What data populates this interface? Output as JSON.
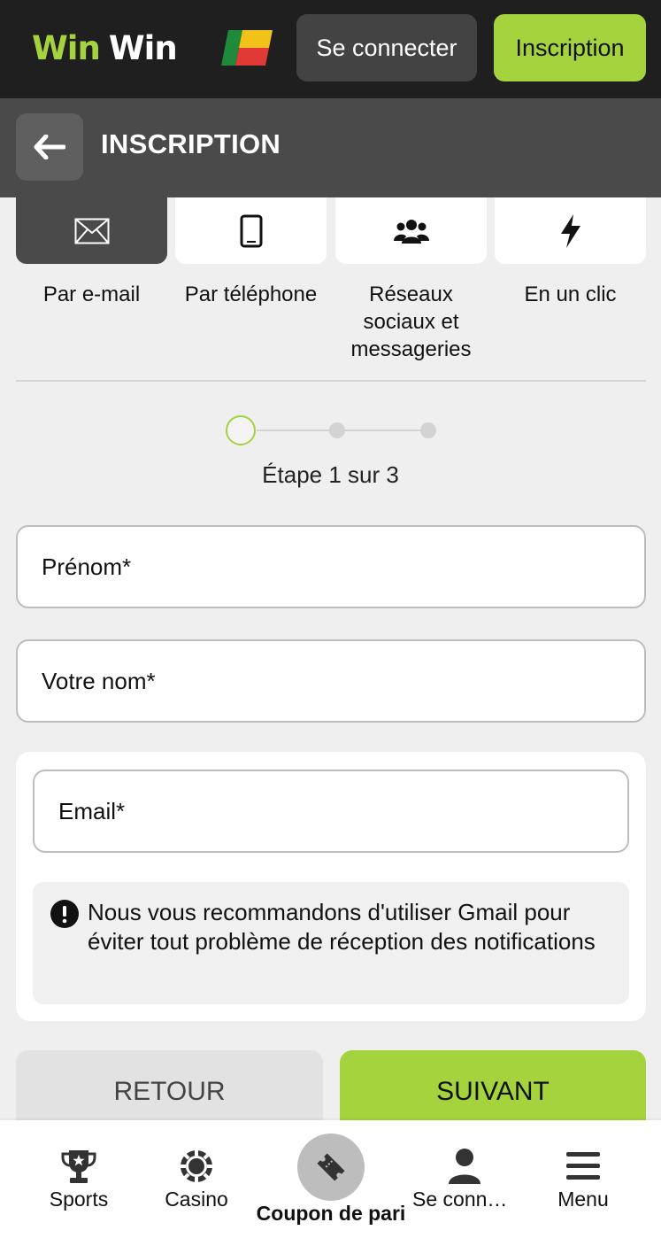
{
  "header": {
    "logo_part1": "Win",
    "logo_part2": "Win",
    "login_label": "Se connecter",
    "signup_label": "Inscription"
  },
  "titlebar": {
    "title": "INSCRIPTION"
  },
  "methods": [
    {
      "label": "Par e-mail",
      "icon": "envelope-icon",
      "active": true
    },
    {
      "label": "Par téléphone",
      "icon": "phone-icon",
      "active": false
    },
    {
      "label": "Réseaux sociaux et messageries",
      "icon": "users-icon",
      "active": false
    },
    {
      "label": "En un clic",
      "icon": "lightning-icon",
      "active": false
    }
  ],
  "stepper": {
    "current": 1,
    "total": 3,
    "text": "Étape 1 sur 3"
  },
  "form": {
    "first_name_placeholder": "Prénom*",
    "last_name_placeholder": "Votre nom*",
    "email_placeholder": "Email*",
    "notice": "Nous vous recommandons d'utiliser Gmail pour éviter tout problème de réception des notifications"
  },
  "actions": {
    "back_label": "RETOUR",
    "next_label": "SUIVANT"
  },
  "bottom_nav": {
    "sports": "Sports",
    "casino": "Casino",
    "coupon": "Coupon de pari",
    "login": "Se connecter",
    "menu": "Menu"
  },
  "colors": {
    "accent": "#a4d33d",
    "header_bg": "#1f1f1f",
    "titlebar_bg": "#4a4a4a",
    "page_bg": "#efefef"
  }
}
